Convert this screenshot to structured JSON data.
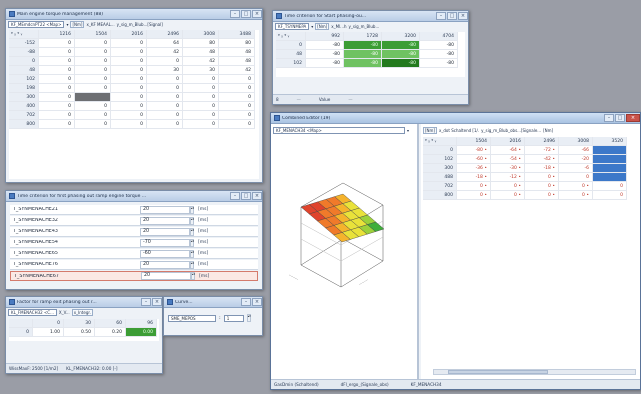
{
  "windows": {
    "torque": {
      "title": "Main engine torque management (88)",
      "toolbar": {
        "map_select": "KF_MEmdcnPT22 <Map>",
        "unit_label": "[Nm]",
        "xaxis_label": "x_KF MEAAL...",
        "yaxis_label": "y_sig_m_Blub...[Signal]"
      },
      "axis_corner": "ᵠ ᵪ ᵠ ᵧ",
      "columns": [
        "1216",
        "1504",
        "2016",
        "2496",
        "3008",
        "3488"
      ],
      "rows": [
        {
          "label": "-152",
          "values": [
            "0",
            "0",
            "0",
            "64",
            "80",
            "80"
          ]
        },
        {
          "label": "-88",
          "values": [
            "0",
            "0",
            "0",
            "42",
            "48",
            "48"
          ]
        },
        {
          "label": "0",
          "values": [
            "0",
            "0",
            "0",
            "0",
            "42",
            "48"
          ]
        },
        {
          "label": "48",
          "values": [
            "0",
            "0",
            "0",
            "30",
            "30",
            "42"
          ]
        },
        {
          "label": "102",
          "values": [
            "0",
            "0",
            "0",
            "0",
            "0",
            "0"
          ]
        },
        {
          "label": "198",
          "values": [
            "0",
            "0",
            "0",
            "0",
            "0",
            "0"
          ]
        },
        {
          "label": "300",
          "values": [
            "0",
            "",
            "0",
            "0",
            "0",
            "0"
          ]
        },
        {
          "label": "400",
          "values": [
            "0",
            "0",
            "0",
            "0",
            "0",
            "0"
          ]
        },
        {
          "label": "702",
          "values": [
            "0",
            "0",
            "0",
            "0",
            "0",
            "0"
          ]
        },
        {
          "label": "800",
          "values": [
            "0",
            "0",
            "0",
            "0",
            "0",
            "0"
          ]
        }
      ]
    },
    "start": {
      "title": "Time criterion for Start phasing-ou...",
      "toolbar": {
        "map_select": "KF_TSYNMEPA",
        "unit_label": "[Nm]",
        "xaxis_label": "x_Ml...h",
        "yaxis_label": "y_sig_m_Blub..."
      },
      "axis_corner": "ᵠ ᵪ ᵠ ᵧ",
      "columns": [
        "992",
        "1728",
        "3200",
        "4704"
      ],
      "rows": [
        {
          "label": "0",
          "values": [
            "-80",
            "-80",
            "-80",
            "-80"
          ]
        },
        {
          "label": "48",
          "values": [
            "-80",
            "-80",
            "-80",
            "-80"
          ]
        },
        {
          "label": "102",
          "values": [
            "-80",
            "-80",
            "-80",
            "-80"
          ]
        }
      ],
      "status_left": "8",
      "status_mid": "Value"
    },
    "combined": {
      "title": "Combined Editor (19)",
      "map_select": "KF_MENACH34 <Map>",
      "toolbar": {
        "unit_label": "[Nm]",
        "xaxis_label": "x_dot Schaltend [1/.",
        "yaxis_label": "y_sig_m_Blub_obs...[Signale...",
        "extra": "[Nm]"
      },
      "axis_corner": "ᵠ ᵪ ᵠ ᵧ",
      "columns": [
        "1504",
        "2016",
        "2496",
        "3008",
        "3520"
      ],
      "rows": [
        {
          "label": "0",
          "values": [
            "-80 •",
            "-64 •",
            "-72 •",
            "-66",
            ""
          ]
        },
        {
          "label": "102",
          "values": [
            "-60 •",
            "-54 •",
            "-42 •",
            "-20",
            ""
          ]
        },
        {
          "label": "300",
          "values": [
            "-36 •",
            "-30 •",
            "-18 •",
            "-6",
            ""
          ]
        },
        {
          "label": "488",
          "values": [
            "-18 •",
            "-12 •",
            "0 •",
            "0",
            ""
          ]
        },
        {
          "label": "702",
          "values": [
            "0 •",
            "0 •",
            "0 •",
            "0 •",
            "0"
          ]
        },
        {
          "label": "800",
          "values": [
            "0 •",
            "0 •",
            "0 •",
            "0 •",
            "0"
          ]
        }
      ],
      "status": [
        "GasDmin (Schaltend)",
        "dFl_ergo_(Signale_obs)",
        "KF_MENACH34"
      ]
    },
    "phasing": {
      "title": "Time criterion for first phasing out ramp engine torque ...",
      "params": [
        {
          "name": "T_SYNMENACHE21",
          "value": "20",
          "unit": "[ms]"
        },
        {
          "name": "T_SYNMENACHE32",
          "value": "20",
          "unit": "[ms]"
        },
        {
          "name": "T_SYNMENACHE43",
          "value": "20",
          "unit": "[ms]"
        },
        {
          "name": "T_SYNMENACHE54",
          "value": "-70",
          "unit": "[ms]"
        },
        {
          "name": "T_SYNMENACHE65",
          "value": "-60",
          "unit": "[ms]"
        },
        {
          "name": "T_SYNMENACHE76",
          "value": "20",
          "unit": "[ms]"
        },
        {
          "name": "T_SYNMENACHE67",
          "value": "20",
          "unit": "[ms]"
        }
      ]
    },
    "ramp": {
      "title": "Factor for ramp exit phasing out r...",
      "toolbar": {
        "map_select": "KL_FMENACH32 <C...",
        "xaxis_label": "X_V...",
        "yaxis_btn": "x_Integr."
      },
      "columns": [
        "0",
        "30",
        "60",
        "96"
      ],
      "row_label": "0",
      "values": [
        "1.00",
        "0.50",
        "0.20",
        "0.00"
      ],
      "status": [
        "WissMaxF: 2500 [1/m2]",
        "KL_FMENACH32: 0.00 [-]"
      ]
    },
    "curve": {
      "title": "Curve...",
      "field_label": "SME_MEPOS",
      "field_value": "1"
    }
  }
}
